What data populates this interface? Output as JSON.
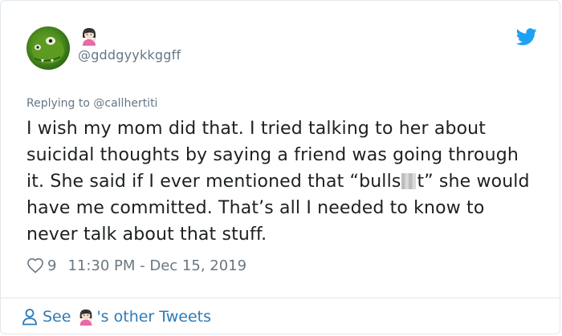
{
  "tweet": {
    "handle": "@gddgyykkggff",
    "replying_prefix": "Replying to ",
    "replying_to": "@callhertiti",
    "text_part1": "I wish my mom did that. I tried talking to her about suicidal thoughts by saying a friend was going through it. She said if I ever mentioned that “bulls",
    "text_part2": "t” she would have me committed. That’s all I needed to know to never talk about that stuff.",
    "likes": "9",
    "timestamp": "11:30 PM - Dec 15, 2019"
  },
  "footer": {
    "see_label": "See",
    "others_label": "'s other Tweets"
  },
  "icons": {
    "brand": "twitter-bird-icon",
    "like": "heart-outline-icon",
    "person": "person-icon",
    "emoji": "woman-tipping-hand-emoji"
  },
  "colors": {
    "twitter_blue": "#1da1f2",
    "link_blue": "#2b7bb9",
    "muted": "#657786",
    "text": "#1c2022"
  }
}
